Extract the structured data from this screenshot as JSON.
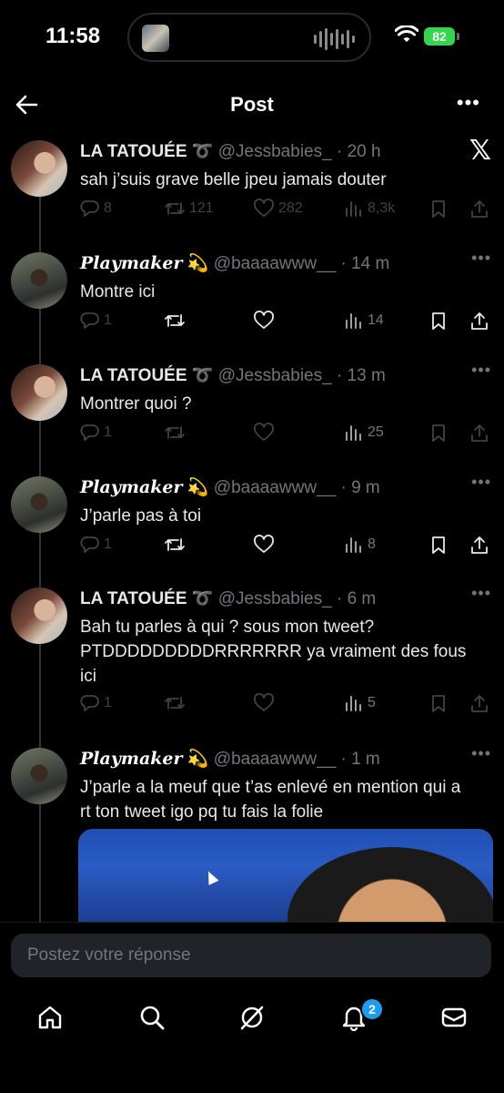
{
  "status": {
    "time": "11:58",
    "battery": "82"
  },
  "header": {
    "title": "Post"
  },
  "tweets": [
    {
      "name": "LA TATOUÉE",
      "name_suffix": "➰",
      "handle": "@Jessbabies_",
      "time": "· 20 h",
      "text": "sah j’suis grave belle jpeu jamais douter",
      "replies": "8",
      "retweets": "121",
      "likes": "282",
      "views": "8,3k"
    },
    {
      "name": "Playmaker",
      "name_suffix": "💫",
      "handle": "@baaaawww__",
      "time": "· 14 m",
      "text": "Montre ici",
      "replies": "1",
      "retweets": "",
      "likes": "",
      "views": "14"
    },
    {
      "name": "LA TATOUÉE",
      "name_suffix": "➰",
      "handle": "@Jessbabies_",
      "time": "· 13 m",
      "text": "Montrer quoi ?",
      "replies": "1",
      "retweets": "",
      "likes": "",
      "views": "25"
    },
    {
      "name": "Playmaker",
      "name_suffix": "💫",
      "handle": "@baaaawww__",
      "time": "· 9 m",
      "text": "J’parle pas à toi",
      "replies": "1",
      "retweets": "",
      "likes": "",
      "views": "8"
    },
    {
      "name": "LA TATOUÉE",
      "name_suffix": "➰",
      "handle": "@Jessbabies_",
      "time": "· 6 m",
      "text": "Bah tu parles à qui ? sous mon tweet? PTDDDDDDDDDRRRRRRR ya vraiment des fous ici",
      "replies": "1",
      "retweets": "",
      "likes": "",
      "views": "5"
    },
    {
      "name": "Playmaker",
      "name_suffix": "💫",
      "handle": "@baaaawww__",
      "time": "· 1 m",
      "text": "J’parle a la meuf que t’as enlevé en mention qui a rt ton tweet igo pq tu fais la folie"
    }
  ],
  "reply": {
    "placeholder": "Postez votre réponse"
  },
  "nav": {
    "notifications_badge": "2"
  }
}
